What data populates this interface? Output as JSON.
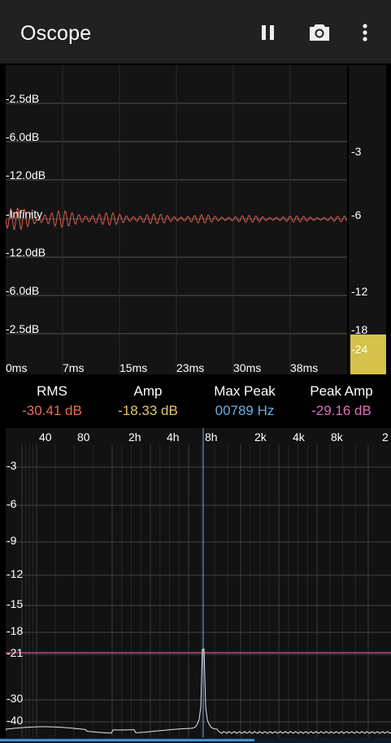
{
  "appbar": {
    "title": "Oscope",
    "icons": {
      "pause": "pause-icon",
      "camera": "camera-icon",
      "more": "more-vert-icon"
    }
  },
  "scope": {
    "y_labels": [
      "-2.5dB",
      "-6.0dB",
      "-12.0dB",
      "-Infinity",
      "-12.0dB",
      "-6.0dB",
      "-2.5dB"
    ],
    "x_labels": [
      "0ms",
      "7ms",
      "15ms",
      "23ms",
      "30ms",
      "38ms"
    ],
    "trace_color": "#e0584a"
  },
  "meter": {
    "labels": [
      "-3",
      "-6",
      "-12",
      "-18",
      "-24"
    ],
    "fill_color": "#d4c24a"
  },
  "stats": [
    {
      "label": "RMS",
      "value": "-30.41 dB",
      "color": "#f06a5a"
    },
    {
      "label": "Amp",
      "value": "-18.33 dB",
      "color": "#e2c66a"
    },
    {
      "label": "Max Peak",
      "value": "00789 Hz",
      "color": "#6ab0e8"
    },
    {
      "label": "Peak Amp",
      "value": "-29.16 dB",
      "color": "#e070b0"
    }
  ],
  "spectrum": {
    "freq_labels": [
      "40",
      "80",
      "2h",
      "4h",
      "8h",
      "2k",
      "4k",
      "8k",
      "2"
    ],
    "db_labels": [
      "-3",
      "-6",
      "-9",
      "-12",
      "-15",
      "-18",
      "-21",
      "-30",
      "-40"
    ],
    "peak_line_color": "#5ab8e0",
    "level_line_color": "#c0407a"
  },
  "bottombar": {
    "progress": 0.65
  }
}
